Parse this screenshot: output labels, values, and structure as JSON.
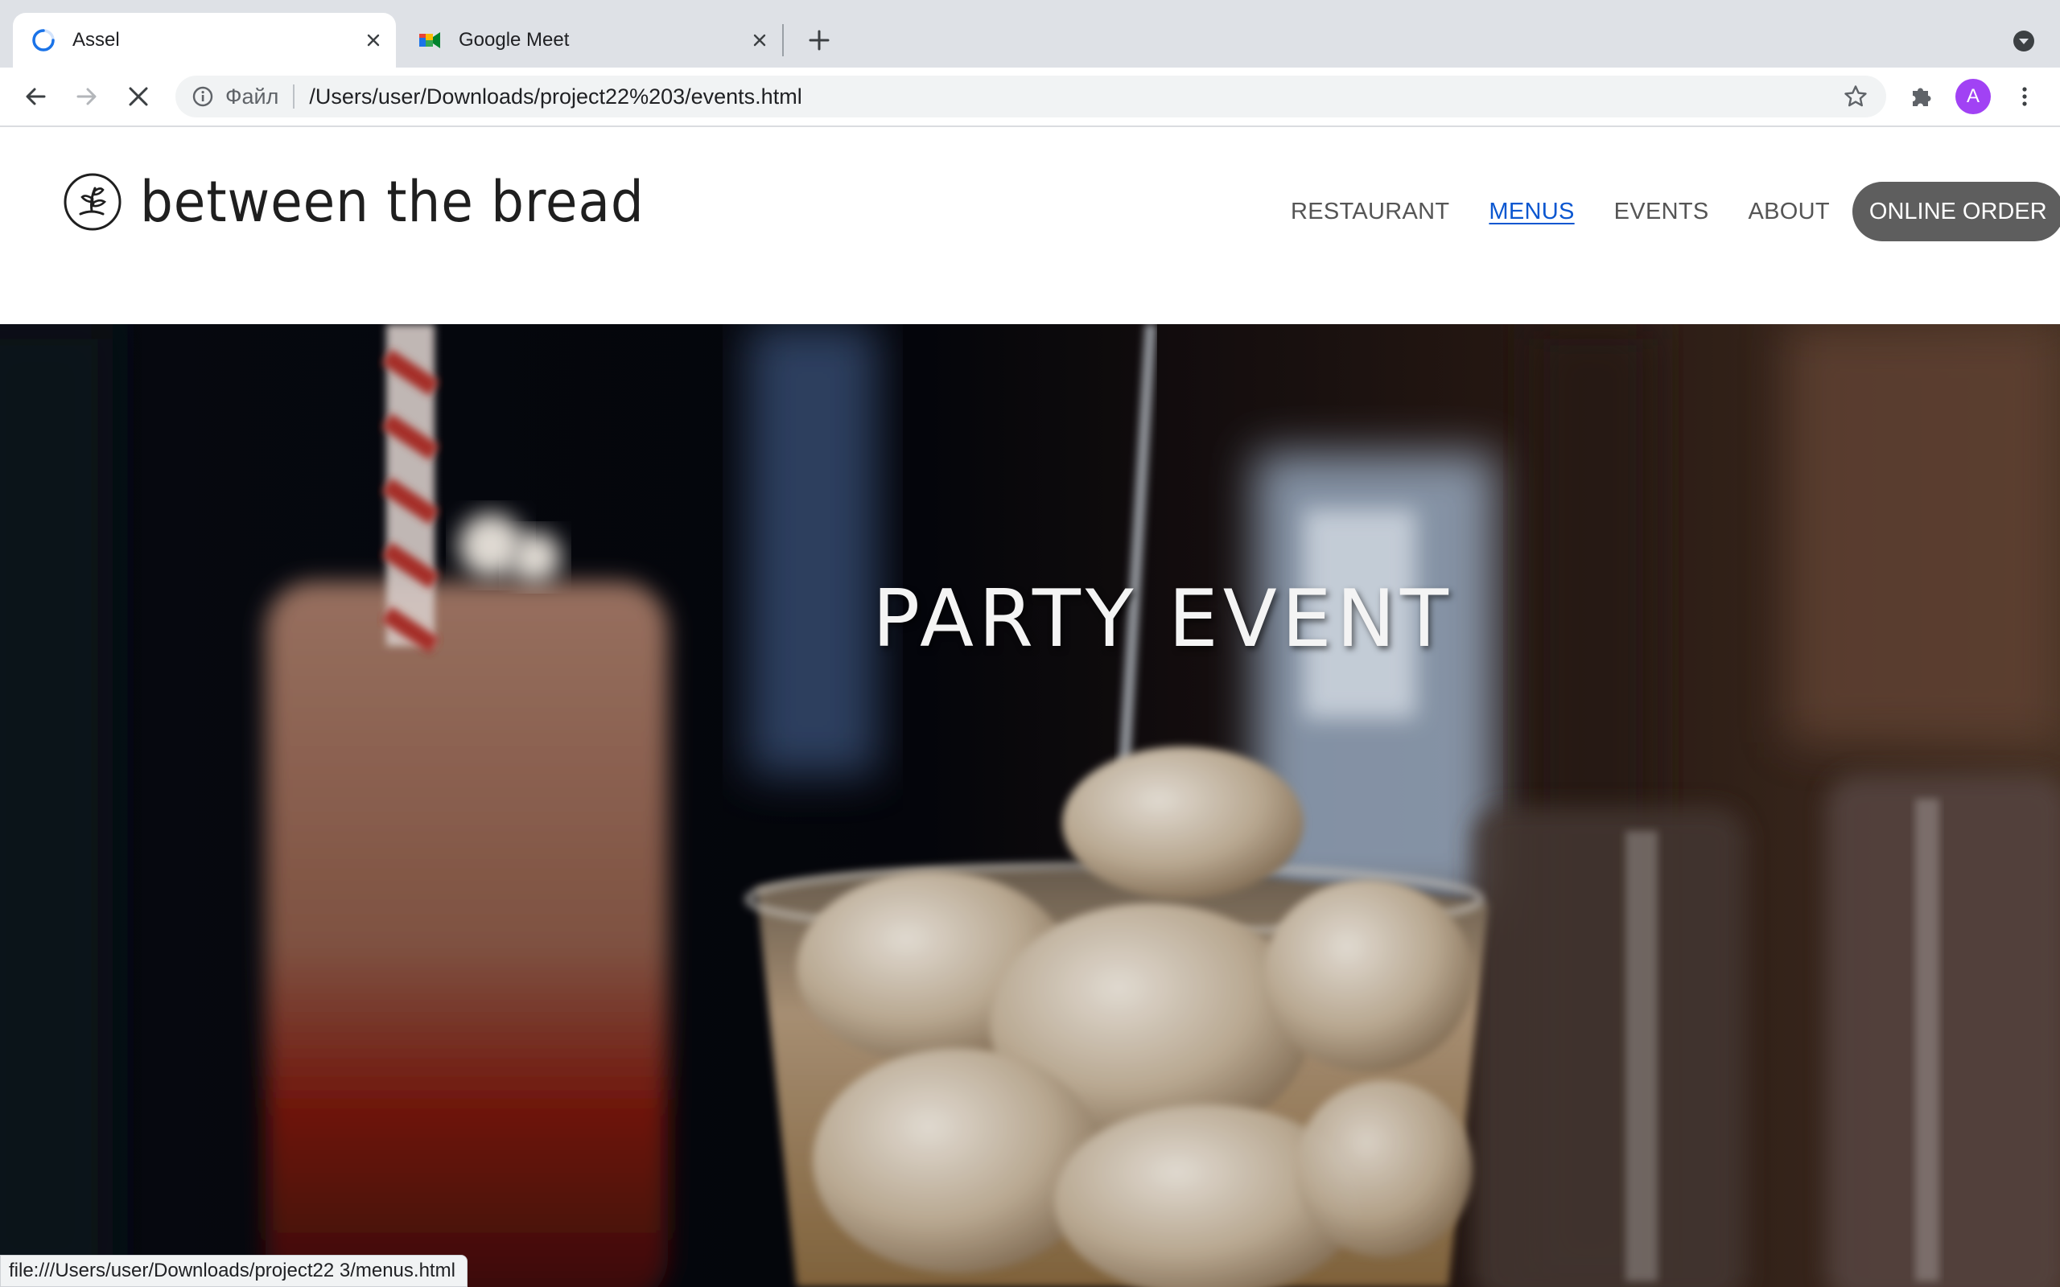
{
  "browser": {
    "tabs": [
      {
        "title": "Assel",
        "icon": "loading-spinner-icon",
        "active": true
      },
      {
        "title": "Google Meet",
        "icon": "google-meet-icon",
        "active": false
      }
    ],
    "address_bar": {
      "scheme_label": "Файл",
      "url": "/Users/user/Downloads/project22%203/events.html"
    },
    "profile_initial": "A",
    "status_bar_url": "file:///Users/user/Downloads/project22 3/menus.html"
  },
  "site": {
    "brand_name": "between the bread",
    "nav": [
      {
        "label": "RESTAURANT",
        "active": false
      },
      {
        "label": "MENUS",
        "active": true
      },
      {
        "label": "EVENTS",
        "active": false
      },
      {
        "label": "ABOUT",
        "active": false
      }
    ],
    "cta_label": "ONLINE ORDER",
    "hero_title": "PARTY EVENT"
  },
  "colors": {
    "tab_strip": "#dee1e6",
    "nav_active": "#0b57d0",
    "cta_background": "#5e5e5e",
    "avatar": "#a142f4"
  }
}
